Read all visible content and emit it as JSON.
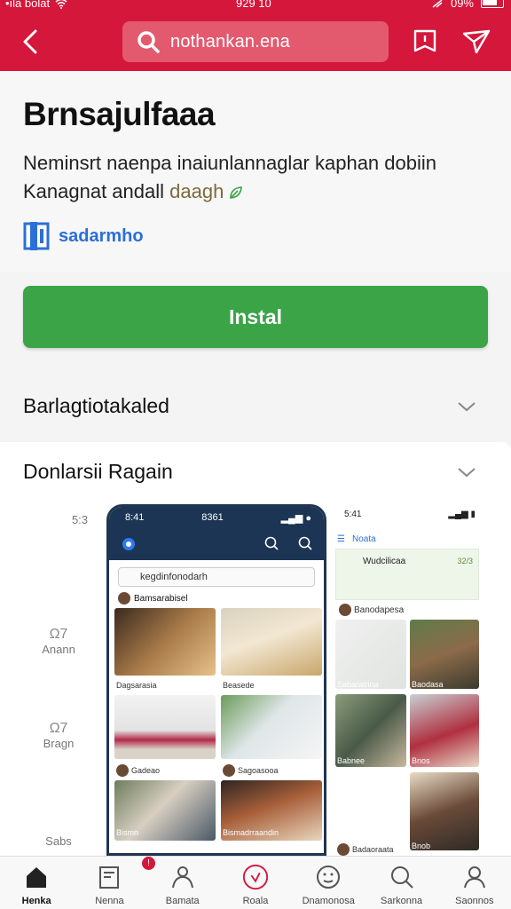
{
  "status_bar": {
    "left": "•ıla bolat",
    "time": "929 10",
    "battery": "09%"
  },
  "header": {
    "back_icon": "chevron-left-icon",
    "search_query": "nothankan.ena",
    "bookmark_icon": "bookmark-icon",
    "share_icon": "send-icon",
    "brand_color": "#d4173a"
  },
  "app": {
    "title": "Brnsajulfaaa",
    "description_line1": "Neminsrt naenpa inaiunlannaglar kaphan dobiin",
    "description_line2": "Kanagnat andall",
    "description_accent": "daagh",
    "developer": "sadarmho",
    "install_label": "Instal",
    "install_color": "#3aa447"
  },
  "sections": [
    {
      "label": "Barlagtiotakaled"
    },
    {
      "label": "Donlarsii Ragain"
    }
  ],
  "gallery": {
    "side_labels": [
      {
        "n": "",
        "t": "5:3"
      },
      {
        "n": "Ω7",
        "t": "Anann"
      },
      {
        "n": "Ω7",
        "t": "Bragn"
      },
      {
        "n": "",
        "t": "Sabs"
      }
    ],
    "screen1": {
      "time": "8:41",
      "clock": "8361",
      "search_text": "kegdinfonodarh",
      "user": "Bamsarabisel",
      "captions": [
        "Dagsarasia",
        "Beasede",
        "Gadeao",
        "Sagoasooa",
        "Bismn",
        "Bismadrraandin"
      ]
    },
    "screen2": {
      "time": "5:41",
      "nav_title": "Noata",
      "card_title": "Wudcilicaa",
      "card_count": "32/3",
      "user": "Banodapesa",
      "captions": [
        "Sabaratrina",
        "Baodasa",
        "Babnee",
        "Bnos",
        "Badaoraata",
        "Bnob"
      ]
    }
  },
  "bottom_nav": [
    {
      "label": "Henka",
      "icon": "home-icon",
      "active": true
    },
    {
      "label": "Nenna",
      "icon": "document-icon",
      "badge": "!"
    },
    {
      "label": "Bamata",
      "icon": "people-icon"
    },
    {
      "label": "Roala",
      "icon": "compass-icon"
    },
    {
      "label": "Dnamonosa",
      "icon": "smiley-icon"
    },
    {
      "label": "Sarkonna",
      "icon": "search-icon"
    },
    {
      "label": "Saonnos",
      "icon": "person-icon"
    }
  ]
}
